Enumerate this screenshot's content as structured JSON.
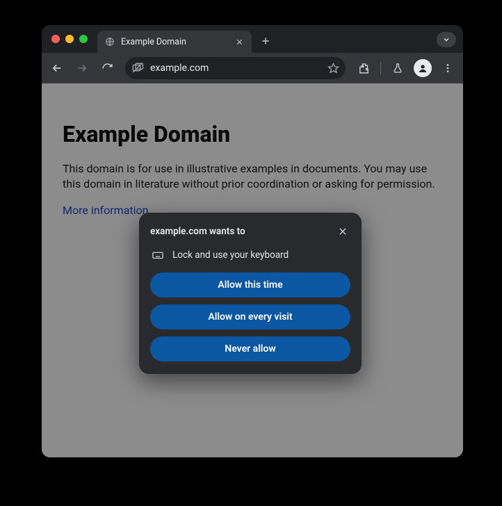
{
  "tab": {
    "title": "Example Domain"
  },
  "toolbar": {
    "url": "example.com"
  },
  "page": {
    "heading": "Example Domain",
    "paragraph": "This domain is for use in illustrative examples in documents. You may use this domain in literature without prior coordination or asking for permission.",
    "link_text": "More information..."
  },
  "dialog": {
    "title": "example.com wants to",
    "permission": "Lock and use your keyboard",
    "buttons": {
      "allow_once": "Allow this time",
      "allow_always": "Allow on every visit",
      "never": "Never allow"
    }
  }
}
